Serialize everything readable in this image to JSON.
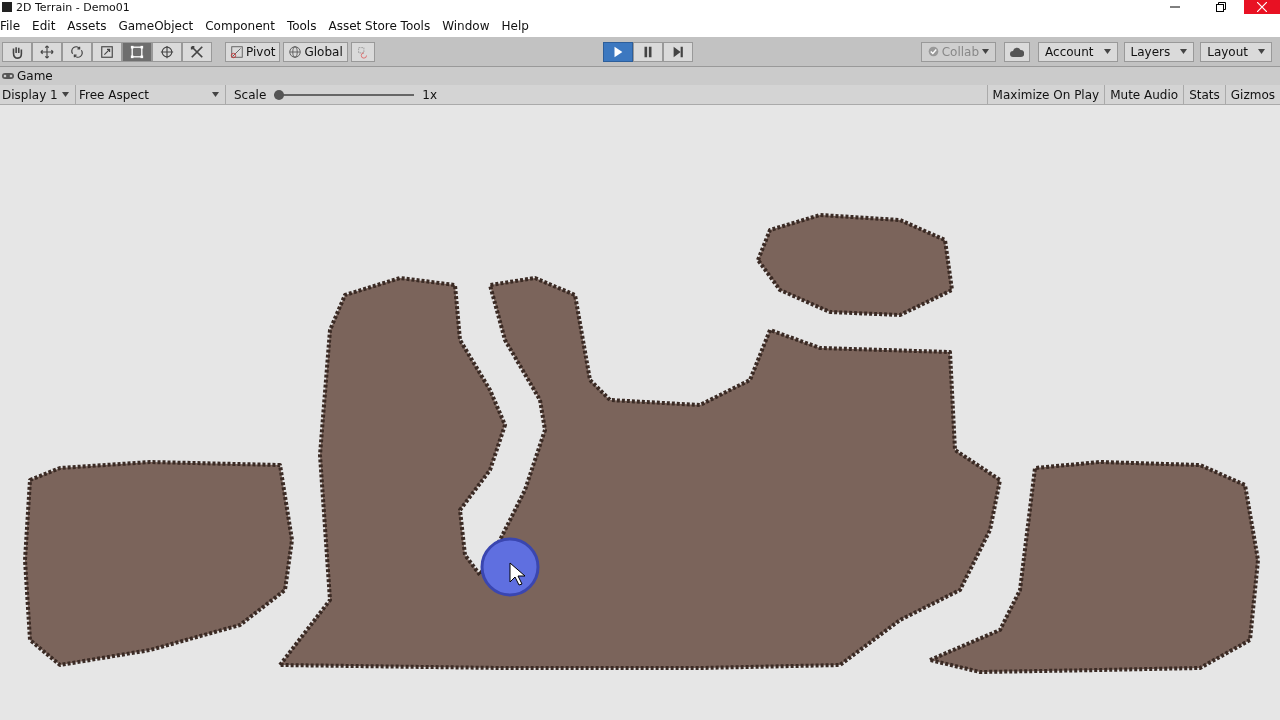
{
  "window": {
    "title": "2D Terrain - Demo01"
  },
  "menu": [
    "File",
    "Edit",
    "Assets",
    "GameObject",
    "Component",
    "Tools",
    "Asset Store Tools",
    "Window",
    "Help"
  ],
  "tools": [
    {
      "kind": "hand",
      "selected": false
    },
    {
      "kind": "move",
      "selected": false
    },
    {
      "kind": "rotate",
      "selected": false
    },
    {
      "kind": "scale",
      "selected": false
    },
    {
      "kind": "rect",
      "selected": true
    },
    {
      "kind": "transform",
      "selected": false
    },
    {
      "kind": "custom",
      "selected": false
    }
  ],
  "pivot_buttons": [
    {
      "kind": "pivot",
      "label": "Pivot"
    },
    {
      "kind": "global",
      "label": "Global"
    }
  ],
  "play_controls": [
    {
      "kind": "play",
      "selected": true
    },
    {
      "kind": "pause",
      "selected": false
    },
    {
      "kind": "step",
      "selected": false
    }
  ],
  "collab": {
    "label": "Collab",
    "disabled": true
  },
  "right_dropdowns": [
    "Account",
    "Layers",
    "Layout"
  ],
  "game_tab": {
    "label": "Game"
  },
  "game_toolbar": {
    "display": "Display 1",
    "aspect": "Free Aspect",
    "scale_label": "Scale",
    "scale": {
      "level": 0
    },
    "scale_reading": "1x",
    "toggles": [
      "Maximize On Play",
      "Mute Audio",
      "Stats",
      "Gizmos"
    ]
  }
}
